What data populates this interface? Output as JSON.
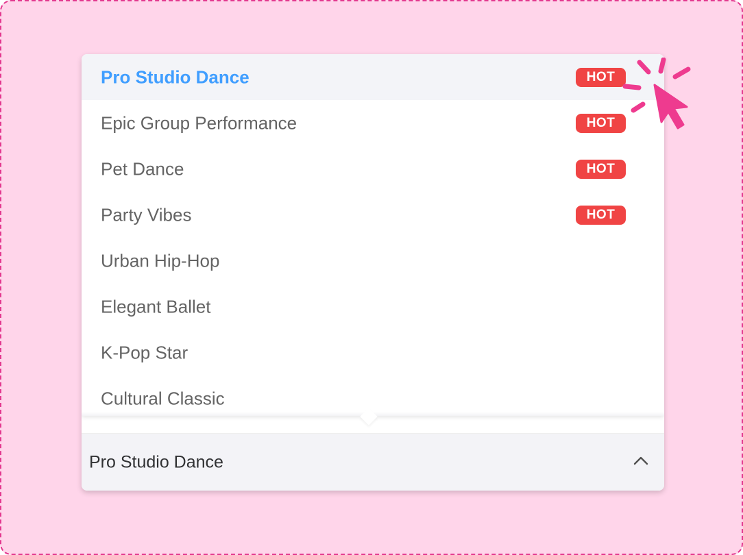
{
  "dropdown": {
    "items": [
      {
        "label": "Pro Studio Dance",
        "badge": "HOT",
        "selected": true
      },
      {
        "label": "Epic Group Performance",
        "badge": "HOT",
        "selected": false
      },
      {
        "label": "Pet Dance",
        "badge": "HOT",
        "selected": false
      },
      {
        "label": "Party Vibes",
        "badge": "HOT",
        "selected": false
      },
      {
        "label": "Urban Hip-Hop",
        "badge": "",
        "selected": false
      },
      {
        "label": "Elegant Ballet",
        "badge": "",
        "selected": false
      },
      {
        "label": "K-Pop Star",
        "badge": "",
        "selected": false
      },
      {
        "label": "Cultural Classic",
        "badge": "",
        "selected": false
      }
    ],
    "selected_value": "Pro Studio Dance",
    "trigger_icon": "chevron-up-icon",
    "pointer_icon": "cursor-click-icon"
  },
  "colors": {
    "background": "#ffd5ea",
    "border_dash": "#e3388f",
    "selected_text": "#409eff",
    "hot_badge": "#f04444",
    "cursor": "#ee3b8f"
  }
}
